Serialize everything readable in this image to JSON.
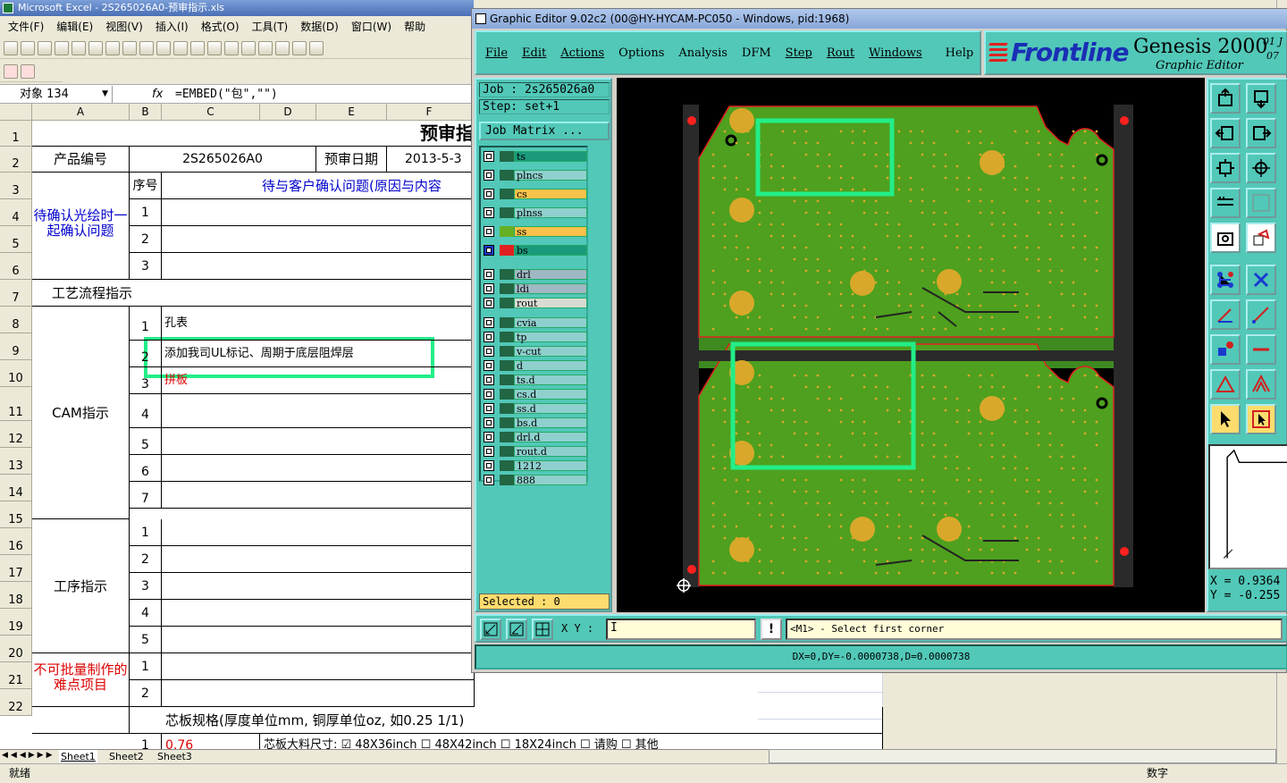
{
  "excel": {
    "title": "Microsoft Excel - 2S265026A0-预审指示.xls",
    "menu": [
      "文件(F)",
      "编辑(E)",
      "视图(V)",
      "插入(I)",
      "格式(O)",
      "工具(T)",
      "数据(D)",
      "窗口(W)",
      "帮助"
    ],
    "name_box": "对象 134",
    "fx": "fx",
    "formula": "=EMBED(\"包\",\"\")",
    "columns": [
      "A",
      "B",
      "C",
      "D",
      "E",
      "F"
    ],
    "rows": [
      "1",
      "2",
      "3",
      "4",
      "5",
      "6",
      "7",
      "8",
      "9",
      "10",
      "11",
      "12",
      "13",
      "14",
      "15",
      "16",
      "17",
      "18",
      "19",
      "20",
      "21",
      "22"
    ],
    "cells": {
      "title": "预审指",
      "product_label": "产品编号",
      "product_value": "2S265026A0",
      "date_label": "预审日期",
      "date_value": "2013-5-3",
      "seq_label": "序号",
      "pending_header": "待与客户确认问题(原因与内容",
      "pending_label": "待确认光绘时一起确认问题",
      "process_label": "工艺流程指示",
      "cam_label": "CAM指示",
      "cam_item1": "孔表",
      "cam_item2": "添加我司UL标记、周期于底层阻焊层",
      "cam_item3": "拼板",
      "op_label": "工序指示",
      "hard_label": "不可批量制作的难点项目",
      "core_spec": "芯板规格(厚度单位mm, 铜厚单位oz, 如0.25 1/1)",
      "row23_val": "0.76",
      "row23_text": "芯板大料尺寸: ☑ 48X36inch ☐ 48X42inch ☐ 18X24inch     ☐ 请购     ☐ 其他"
    },
    "seq": {
      "pending": [
        "1",
        "2",
        "3"
      ],
      "cam": [
        "1",
        "2",
        "3",
        "4",
        "5",
        "6",
        "7"
      ],
      "op": [
        "1",
        "2",
        "3",
        "4",
        "5"
      ],
      "hard": [
        "1",
        "2"
      ],
      "core": "1"
    },
    "sheets": [
      "Sheet1",
      "Sheet2",
      "Sheet3"
    ],
    "status_left": "就绪",
    "status_right": "数字"
  },
  "genesis": {
    "title": "Graphic Editor 9.02c2 (00@HY-HYCAM-PC050 - Windows, pid:1968)",
    "menu": [
      "File",
      "Edit",
      "Actions",
      "Options",
      "Analysis",
      "DFM",
      "Step",
      "Rout",
      "Windows"
    ],
    "help": "Help",
    "logo": "Frontline",
    "product": "Genesis 2000",
    "subtitle": "Graphic Editor",
    "ver1": "01 J",
    "ver2": "07",
    "job_line": "Job  : 2s265026a0",
    "step_line": "Step: set+1",
    "job_matrix": "Job Matrix ...",
    "layers": [
      {
        "name": "ts",
        "color": "#1a9a7a",
        "swatch": "#226644"
      },
      {
        "name": "plncs",
        "color": "#8fd0ce",
        "swatch": "#226644"
      },
      {
        "name": "cs",
        "color": "#f7c24a",
        "swatch": "#226644"
      },
      {
        "name": "plnss",
        "color": "#8fd0ce",
        "swatch": "#226644"
      },
      {
        "name": "ss",
        "color": "#f7c24a",
        "swatch": "#66b024"
      },
      {
        "name": "bs",
        "color": "#1a9a7a",
        "swatch": "#e02020"
      },
      {
        "name": "drl",
        "color": "#a0b8c4",
        "swatch": "#226644"
      },
      {
        "name": "ldi",
        "color": "#a0b8c4",
        "swatch": "#226644"
      },
      {
        "name": "rout",
        "color": "#d8dcd4",
        "swatch": "#226644"
      },
      {
        "name": "cvia",
        "color": "#8fd0ce",
        "swatch": "#226644"
      },
      {
        "name": "tp",
        "color": "#8fd0ce",
        "swatch": "#226644"
      },
      {
        "name": "v-cut",
        "color": "#8fd0ce",
        "swatch": "#226644"
      },
      {
        "name": "d",
        "color": "#8fd0ce",
        "swatch": "#226644"
      },
      {
        "name": "ts.d",
        "color": "#8fd0ce",
        "swatch": "#226644"
      },
      {
        "name": "cs.d",
        "color": "#8fd0ce",
        "swatch": "#226644"
      },
      {
        "name": "ss.d",
        "color": "#8fd0ce",
        "swatch": "#226644"
      },
      {
        "name": "bs.d",
        "color": "#8fd0ce",
        "swatch": "#226644"
      },
      {
        "name": "drl.d",
        "color": "#8fd0ce",
        "swatch": "#226644"
      },
      {
        "name": "rout.d",
        "color": "#8fd0ce",
        "swatch": "#226644"
      },
      {
        "name": "1212",
        "color": "#8fd0ce",
        "swatch": "#226644"
      },
      {
        "name": "888",
        "color": "#8fd0ce",
        "swatch": "#226644"
      }
    ],
    "selected": "Selected : 0",
    "xy_label": "X Y :",
    "xy_value": "I",
    "warn": "!",
    "prompt": "<M1> - Select first corner",
    "status": "DX=0,DY=-0.0000738,D=0.0000738",
    "coord_x": "X  = 0.9364",
    "coord_y": "Y  = -0.255",
    "colors": {
      "pcb": "#4ea01e",
      "pad": "#d9a82a",
      "highlight": "#22ee88",
      "outline": "#e02020"
    }
  }
}
